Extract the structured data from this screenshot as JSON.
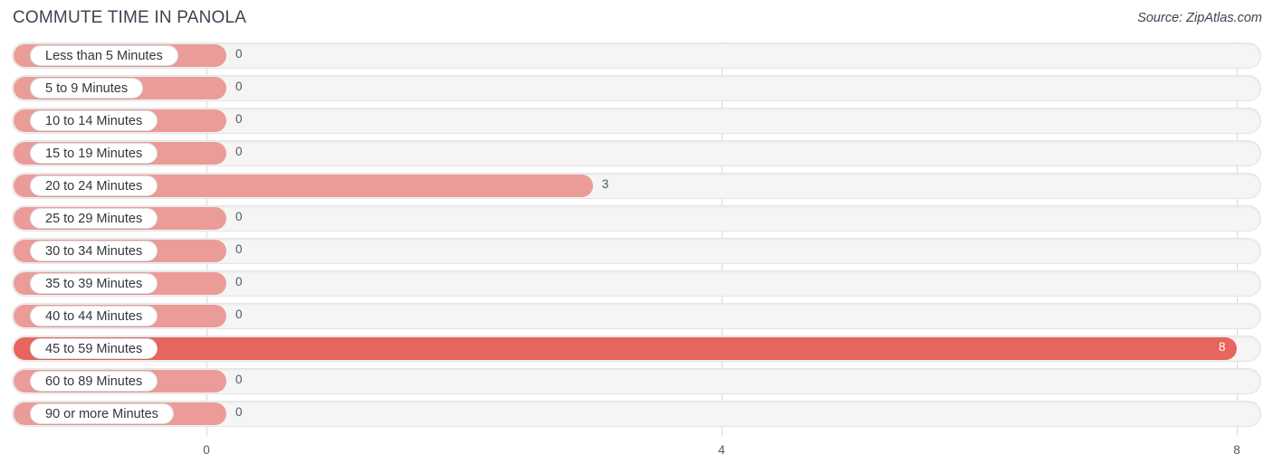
{
  "header": {
    "title": "COMMUTE TIME IN PANOLA",
    "source": "Source: ZipAtlas.com"
  },
  "colors": {
    "bar_low": "#eb9c99",
    "bar_high": "#e8645e",
    "track": "#f5f5f5",
    "grid": "#d8d8d8",
    "text": "#3c4451"
  },
  "chart_data": {
    "type": "bar",
    "orientation": "horizontal",
    "title": "COMMUTE TIME IN PANOLA",
    "xlabel": "",
    "ylabel": "",
    "xlim": [
      0,
      8
    ],
    "grid": true,
    "legend": "none",
    "xticks": [
      "0",
      "4",
      "8"
    ],
    "xtick_values": [
      0,
      4,
      8
    ],
    "categories": [
      "Less than 5 Minutes",
      "5 to 9 Minutes",
      "10 to 14 Minutes",
      "15 to 19 Minutes",
      "20 to 24 Minutes",
      "25 to 29 Minutes",
      "30 to 34 Minutes",
      "35 to 39 Minutes",
      "40 to 44 Minutes",
      "45 to 59 Minutes",
      "60 to 89 Minutes",
      "90 or more Minutes"
    ],
    "values": [
      0,
      0,
      0,
      0,
      3,
      0,
      0,
      0,
      0,
      8,
      0,
      0
    ],
    "value_labels": [
      "0",
      "0",
      "0",
      "0",
      "3",
      "0",
      "0",
      "0",
      "0",
      "8",
      "0",
      "0"
    ]
  },
  "rows": [
    {
      "label": "Less than 5 Minutes",
      "value": 0,
      "value_label": "0",
      "high": false
    },
    {
      "label": "5 to 9 Minutes",
      "value": 0,
      "value_label": "0",
      "high": false
    },
    {
      "label": "10 to 14 Minutes",
      "value": 0,
      "value_label": "0",
      "high": false
    },
    {
      "label": "15 to 19 Minutes",
      "value": 0,
      "value_label": "0",
      "high": false
    },
    {
      "label": "20 to 24 Minutes",
      "value": 3,
      "value_label": "3",
      "high": false
    },
    {
      "label": "25 to 29 Minutes",
      "value": 0,
      "value_label": "0",
      "high": false
    },
    {
      "label": "30 to 34 Minutes",
      "value": 0,
      "value_label": "0",
      "high": false
    },
    {
      "label": "35 to 39 Minutes",
      "value": 0,
      "value_label": "0",
      "high": false
    },
    {
      "label": "40 to 44 Minutes",
      "value": 0,
      "value_label": "0",
      "high": false
    },
    {
      "label": "45 to 59 Minutes",
      "value": 8,
      "value_label": "8",
      "high": true
    },
    {
      "label": "60 to 89 Minutes",
      "value": 0,
      "value_label": "0",
      "high": false
    },
    {
      "label": "90 or more Minutes",
      "value": 0,
      "value_label": "0",
      "high": false
    }
  ]
}
